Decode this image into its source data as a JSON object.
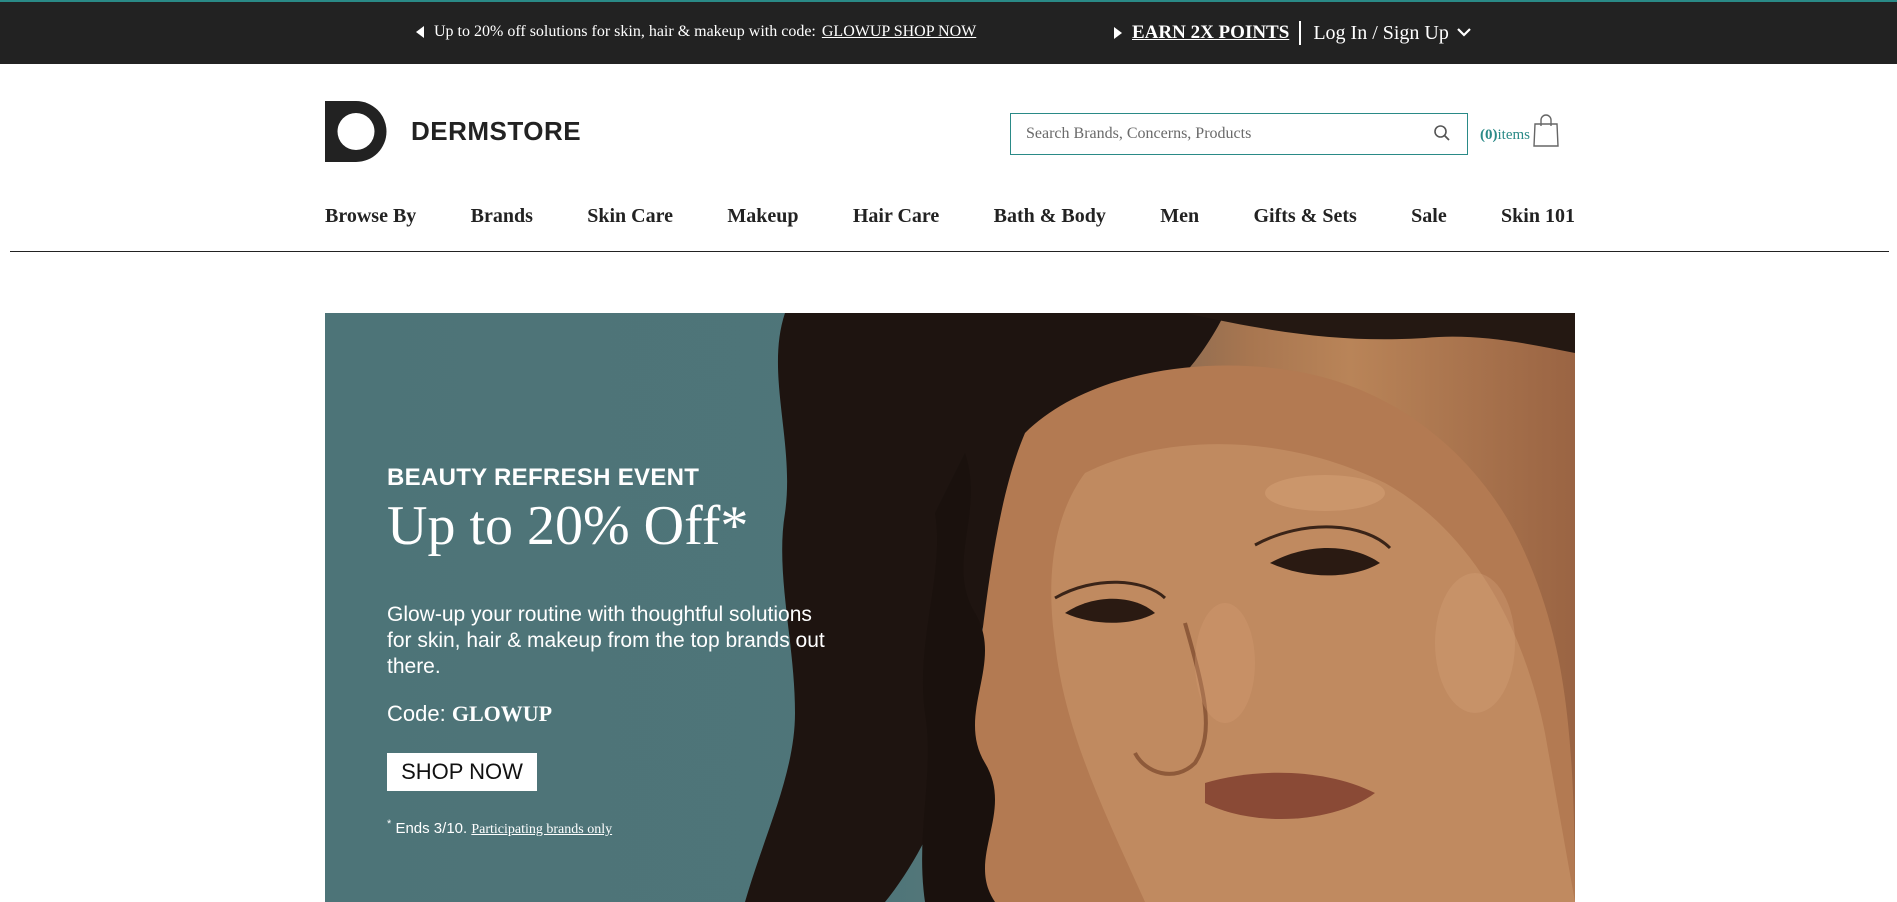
{
  "colors": {
    "topbar_bg": "#222222",
    "accent": "#2a8a87",
    "hero_teal": "#4d7478"
  },
  "topbar": {
    "promo_text": "Up to 20% off solutions for skin, hair & makeup with code:",
    "promo_link": "GLOWUP SHOP NOW",
    "earn_points": "EARN 2X POINTS",
    "login": "Log In / Sign Up"
  },
  "header": {
    "brand": "DERMSTORE",
    "search_placeholder": "Search Brands, Concerns, Products",
    "cart_count": "(0)",
    "cart_label": "items"
  },
  "nav": {
    "items": [
      "Browse By",
      "Brands",
      "Skin Care",
      "Makeup",
      "Hair Care",
      "Bath & Body",
      "Men",
      "Gifts & Sets",
      "Sale",
      "Skin 101"
    ]
  },
  "hero": {
    "eyebrow": "BEAUTY REFRESH EVENT",
    "headline": "Up to 20% Off*",
    "body": "Glow-up your routine with thoughtful solutions for skin, hair & makeup from the top brands out there.",
    "code_label": "Code: ",
    "code_value": "GLOWUP",
    "cta": "SHOP NOW",
    "fine_star": "*",
    "fine_text": " Ends 3/10. ",
    "fine_link": "Participating brands only"
  }
}
